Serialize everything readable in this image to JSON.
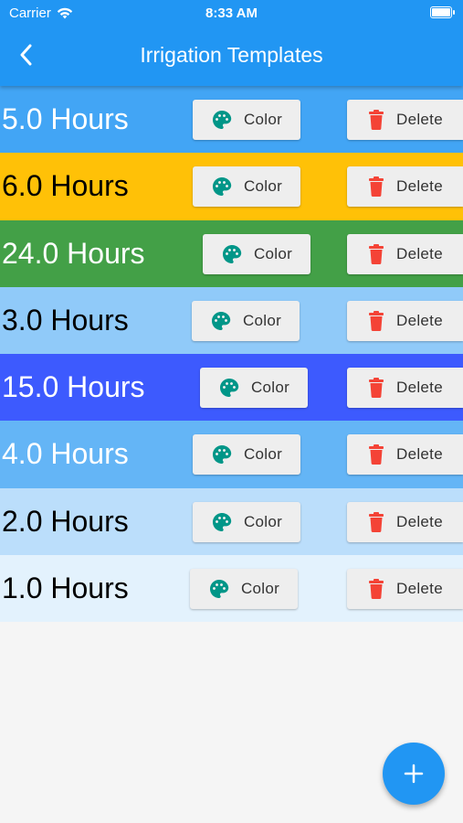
{
  "status_bar": {
    "carrier": "Carrier",
    "time": "8:33 AM"
  },
  "header": {
    "title": "Irrigation Templates",
    "back_icon": "chevron-left-icon"
  },
  "colors": {
    "appbar": "#2196f3",
    "palette_icon": "#009688",
    "delete_icon": "#f44336",
    "fab": "#2196f3"
  },
  "templates": [
    {
      "label": "5.0 Hours",
      "bg": "#42a5f5",
      "text_color": "#ffffff",
      "color_button": "Color",
      "delete_button": "Delete"
    },
    {
      "label": "6.0 Hours",
      "bg": "#ffc107",
      "text_color": "#000000",
      "color_button": "Color",
      "delete_button": "Delete"
    },
    {
      "label": "24.0 Hours",
      "bg": "#43a047",
      "text_color": "#ffffff",
      "color_button": "Color",
      "delete_button": "Delete"
    },
    {
      "label": "3.0 Hours",
      "bg": "#90caf9",
      "text_color": "#000000",
      "color_button": "Color",
      "delete_button": "Delete"
    },
    {
      "label": "15.0 Hours",
      "bg": "#3d5afe",
      "text_color": "#ffffff",
      "color_button": "Color",
      "delete_button": "Delete"
    },
    {
      "label": "4.0 Hours",
      "bg": "#64b5f6",
      "text_color": "#ffffff",
      "color_button": "Color",
      "delete_button": "Delete"
    },
    {
      "label": "2.0 Hours",
      "bg": "#bbdefb",
      "text_color": "#000000",
      "color_button": "Color",
      "delete_button": "Delete"
    },
    {
      "label": "1.0 Hours",
      "bg": "#e3f2fd",
      "text_color": "#000000",
      "color_button": "Color",
      "delete_button": "Delete"
    }
  ],
  "fab": {
    "icon": "plus-icon"
  }
}
